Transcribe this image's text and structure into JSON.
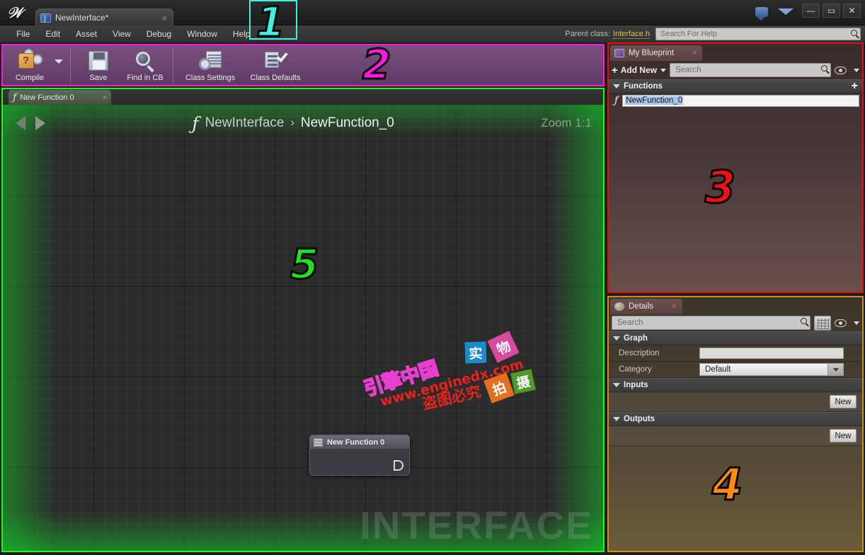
{
  "window": {
    "app_logo": "unreal-logo",
    "asset_tab": {
      "label": "NewInterface*",
      "close": "×",
      "icon": "blueprint-icon"
    },
    "title_icons": [
      "feedback-icon",
      "learn-icon"
    ],
    "controls": {
      "minimize": "—",
      "maximize": "▭",
      "close": "✕"
    }
  },
  "menu": {
    "items": [
      "File",
      "Edit",
      "Asset",
      "View",
      "Debug",
      "Window",
      "Help"
    ],
    "parent_class_label": "Parent class:",
    "parent_class_value": "Interface.h",
    "help_search_placeholder": "Search For Help"
  },
  "toolbar": {
    "items": [
      {
        "label": "Compile",
        "icon": "compile-icon",
        "has_dropdown": true
      },
      {
        "label": "Save",
        "icon": "save-icon",
        "has_dropdown": false
      },
      {
        "label": "Find in CB",
        "icon": "find-in-content-browser-icon",
        "has_dropdown": false
      },
      {
        "label": "Class Settings",
        "icon": "class-settings-icon",
        "has_dropdown": false
      },
      {
        "label": "Class Defaults",
        "icon": "class-defaults-icon",
        "has_dropdown": false
      }
    ]
  },
  "graph": {
    "tab": {
      "label": "New Function 0",
      "icon": "function-icon",
      "close": "×"
    },
    "nav_back": "◀",
    "nav_forward": "▶",
    "breadcrumb": {
      "icon": "function-icon",
      "root": "NewInterface",
      "separator": "›",
      "current": "NewFunction_0"
    },
    "zoom_label": "Zoom 1:1",
    "node": {
      "title": "New Function 0",
      "icon": "function-node-icon",
      "pin": "exec-out-pin"
    },
    "watermark_big": "INTERFACE",
    "watermark": {
      "brand": "引擎中国",
      "url": "www.enginedx.com",
      "notice": "盗图必究",
      "tiles": [
        {
          "char": "实",
          "color": "#1b8ccc"
        },
        {
          "char": "物",
          "color": "#d84a9e"
        },
        {
          "char": "拍",
          "color": "#e2701c"
        },
        {
          "char": "摄",
          "color": "#4f9a26"
        }
      ]
    }
  },
  "my_blueprint": {
    "tab_label": "My Blueprint",
    "tab_icon": "blueprint-icon",
    "tab_close": "×",
    "add_new_label": "Add New",
    "search_placeholder": "Search",
    "eye_icon": "visibility-icon",
    "sections": [
      {
        "title": "Functions",
        "add_glyph": "+",
        "items": [
          {
            "name": "NewFunction_0",
            "icon": "function-icon",
            "editing": true
          }
        ]
      }
    ]
  },
  "details": {
    "tab_label": "Details",
    "tab_icon": "details-icon",
    "tab_close": "×",
    "search_placeholder": "Search",
    "grid_icon": "grid-view-icon",
    "eye_icon": "visibility-icon",
    "groups": [
      {
        "title": "Graph",
        "rows": [
          {
            "label": "Description",
            "type": "text",
            "value": ""
          },
          {
            "label": "Category",
            "type": "select",
            "value": "Default"
          }
        ]
      },
      {
        "title": "Inputs",
        "button": "New"
      },
      {
        "title": "Outputs",
        "button": "New"
      }
    ]
  },
  "annotations": [
    {
      "id": "1",
      "color": "#40f0e0"
    },
    {
      "id": "2",
      "color": "#ff18e0"
    },
    {
      "id": "3",
      "color": "#f01010"
    },
    {
      "id": "4",
      "color": "#ff8c12"
    },
    {
      "id": "5",
      "color": "#22e022"
    }
  ],
  "region_colors": {
    "menu_region": "#40f0e0",
    "toolbar_region": "#ff18e0",
    "my_blueprint_region": "#e01010",
    "details_region": "#d58a1a",
    "graph_region": "#12ff12"
  }
}
